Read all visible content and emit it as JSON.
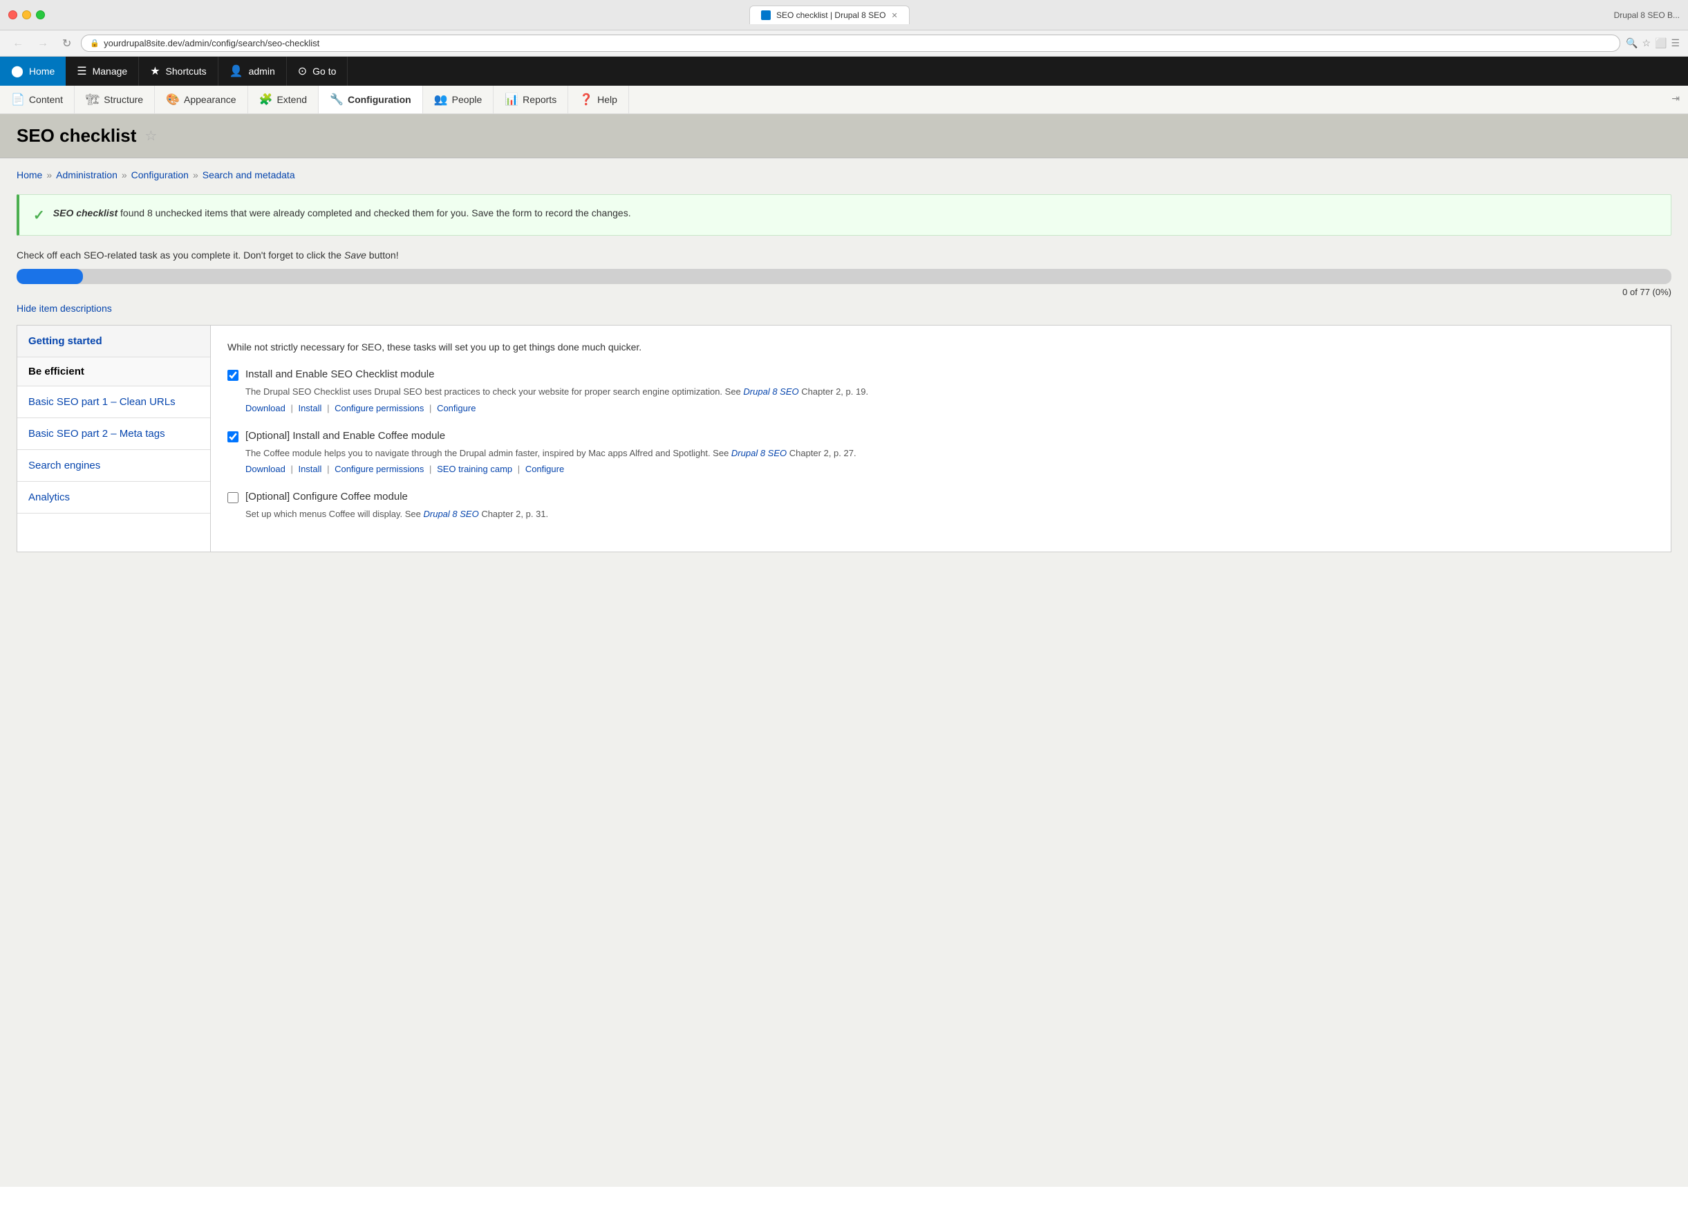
{
  "browser": {
    "title_right": "Drupal 8 SEO B...",
    "tab_label": "SEO checklist | Drupal 8 SEO",
    "url": "yourdrupal8site.dev/admin/config/search/seo-checklist",
    "back_btn": "←",
    "forward_btn": "→",
    "refresh_btn": "↻"
  },
  "admin_bar": {
    "home_label": "Home",
    "manage_label": "Manage",
    "shortcuts_label": "Shortcuts",
    "admin_label": "admin",
    "goto_label": "Go to"
  },
  "secondary_nav": {
    "items": [
      {
        "label": "Content",
        "icon": "📄"
      },
      {
        "label": "Structure",
        "icon": "🏗"
      },
      {
        "label": "Appearance",
        "icon": "🎨"
      },
      {
        "label": "Extend",
        "icon": "🧩"
      },
      {
        "label": "Configuration",
        "icon": "🔧",
        "active": true
      },
      {
        "label": "People",
        "icon": "👥"
      },
      {
        "label": "Reports",
        "icon": "📊"
      },
      {
        "label": "Help",
        "icon": "❓"
      }
    ]
  },
  "page": {
    "title": "SEO checklist",
    "breadcrumb": [
      {
        "label": "Home",
        "href": "#"
      },
      {
        "label": "Administration",
        "href": "#"
      },
      {
        "label": "Configuration",
        "href": "#"
      },
      {
        "label": "Search and metadata",
        "href": "#"
      }
    ]
  },
  "status_message": {
    "text_bold": "SEO checklist",
    "text_rest": " found 8 unchecked items that were already completed and checked them for you. Save the form to record the changes."
  },
  "instruction": "Check off each SEO-related task as you complete it. Don't forget to click the Save button!",
  "progress": {
    "value": 0,
    "total": 77,
    "percent": 0,
    "label": "0 of 77 (0%)"
  },
  "hide_toggle": "Hide item descriptions",
  "sidebar": {
    "items": [
      {
        "label": "Getting started",
        "active": true
      },
      {
        "label": "Be efficient",
        "is_header": true
      },
      {
        "label": "Basic SEO part 1 – Clean URLs"
      },
      {
        "label": "Basic SEO part 2 – Meta tags"
      },
      {
        "label": "Search engines"
      },
      {
        "label": "Analytics"
      }
    ]
  },
  "section_intro": "While not strictly necessary for SEO, these tasks will set you up to get things done much quicker.",
  "checklist_items": [
    {
      "id": "item1",
      "checked": true,
      "title": "Install and Enable SEO Checklist module",
      "desc_plain": "The Drupal SEO Checklist uses Drupal SEO best practices to check your website for proper search engine optimization. See ",
      "desc_link_label": "Drupal 8 SEO",
      "desc_link": "#",
      "desc_chapter": " Chapter 2, p. 19.",
      "links": [
        {
          "label": "Download",
          "href": "#"
        },
        {
          "label": "Install",
          "href": "#"
        },
        {
          "label": "Configure permissions",
          "href": "#"
        },
        {
          "label": "Configure",
          "href": "#"
        }
      ]
    },
    {
      "id": "item2",
      "checked": true,
      "title": "[Optional] Install and Enable Coffee module",
      "desc_plain": "The Coffee module helps you to navigate through the Drupal admin faster, inspired by Mac apps Alfred and Spotlight. See ",
      "desc_link_label": "Drupal 8 SEO",
      "desc_link": "#",
      "desc_chapter": " Chapter 2, p. 27.",
      "links": [
        {
          "label": "Download",
          "href": "#"
        },
        {
          "label": "Install",
          "href": "#"
        },
        {
          "label": "Configure permissions",
          "href": "#"
        },
        {
          "label": "SEO training camp",
          "href": "#"
        },
        {
          "label": "Configure",
          "href": "#"
        }
      ]
    },
    {
      "id": "item3",
      "checked": false,
      "title": "[Optional] Configure Coffee module",
      "desc_plain": "Set up which menus Coffee will display. See ",
      "desc_link_label": "Drupal 8 SEO",
      "desc_link": "#",
      "desc_chapter": " Chapter 2, p. 31.",
      "links": []
    }
  ]
}
